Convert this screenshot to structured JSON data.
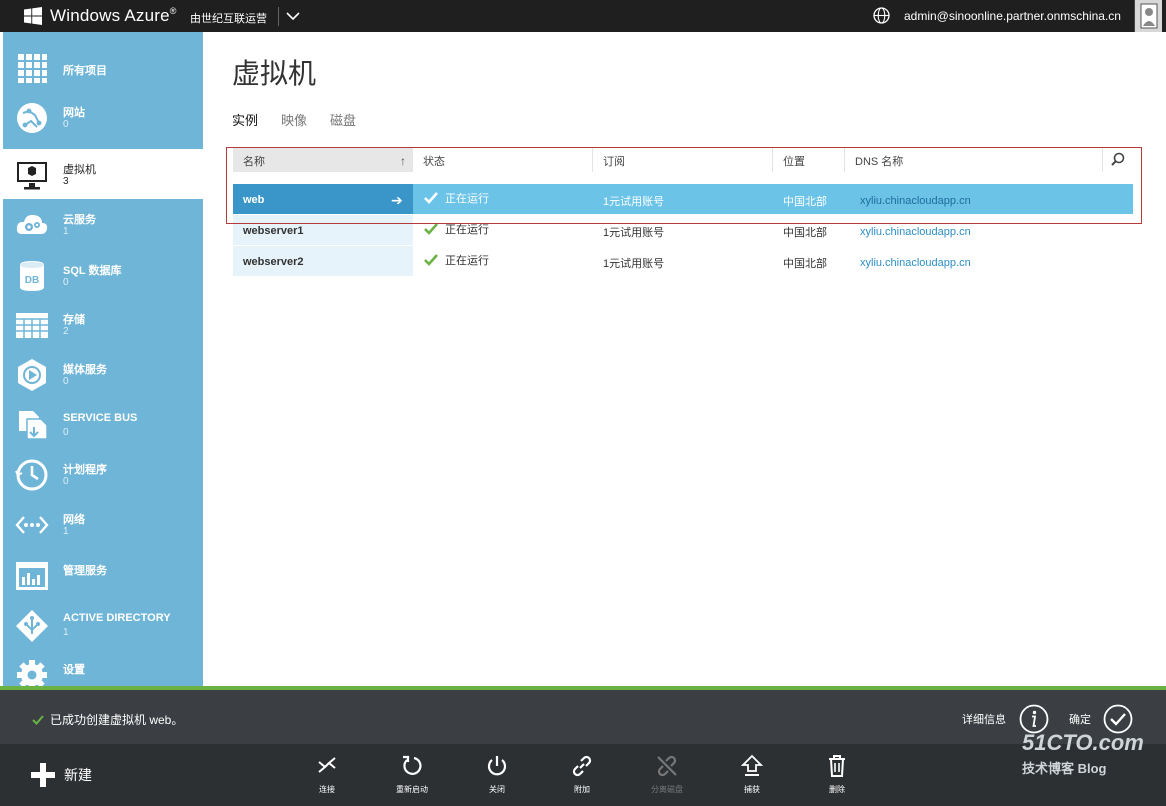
{
  "topbar": {
    "product": "Windows Azure",
    "product_sup": "®",
    "operator": "由世纪互联运营",
    "account": "admin@sinoonline.partner.onmschina.cn"
  },
  "sidebar": {
    "items": [
      {
        "label": "所有项目",
        "count": "",
        "icon": "grid-icon"
      },
      {
        "label": "网站",
        "count": "0",
        "icon": "website-globe-icon"
      },
      {
        "label": "虚拟机",
        "count": "3",
        "icon": "monitor-icon"
      },
      {
        "label": "云服务",
        "count": "1",
        "icon": "cloud-gear-icon"
      },
      {
        "label": "SQL 数据库",
        "count": "0",
        "icon": "database-icon"
      },
      {
        "label": "存储",
        "count": "2",
        "icon": "storage-table-icon"
      },
      {
        "label": "媒体服务",
        "count": "0",
        "icon": "media-play-icon"
      },
      {
        "label": "SERVICE BUS",
        "count": "0",
        "icon": "service-bus-icon"
      },
      {
        "label": "计划程序",
        "count": "0",
        "icon": "scheduler-clock-icon"
      },
      {
        "label": "网络",
        "count": "1",
        "icon": "network-icon"
      },
      {
        "label": "管理服务",
        "count": "",
        "icon": "management-icon"
      },
      {
        "label": "ACTIVE DIRECTORY",
        "count": "1",
        "icon": "active-directory-icon"
      },
      {
        "label": "设置",
        "count": "",
        "icon": "settings-gear-icon"
      }
    ]
  },
  "main": {
    "title": "虚拟机",
    "tabs": [
      "实例",
      "映像",
      "磁盘"
    ],
    "columns": [
      "名称",
      "状态",
      "订阅",
      "位置",
      "DNS 名称"
    ],
    "rows": [
      {
        "name": "web",
        "status": "正在运行",
        "subscription": "1元试用账号",
        "location": "中国北部",
        "dns": "xyliu.chinacloudapp.cn"
      },
      {
        "name": "webserver1",
        "status": "正在运行",
        "subscription": "1元试用账号",
        "location": "中国北部",
        "dns": "xyliu.chinacloudapp.cn"
      },
      {
        "name": "webserver2",
        "status": "正在运行",
        "subscription": "1元试用账号",
        "location": "中国北部",
        "dns": "xyliu.chinacloudapp.cn"
      }
    ]
  },
  "notification": {
    "message": "已成功创建虚拟机 web。",
    "details_label": "详细信息",
    "ok_label": "确定"
  },
  "commandbar": {
    "new_label": "新建",
    "commands": [
      {
        "label": "连接",
        "icon": "connect-icon",
        "enabled": true
      },
      {
        "label": "重新启动",
        "icon": "restart-icon",
        "enabled": true
      },
      {
        "label": "关闭",
        "icon": "power-icon",
        "enabled": true
      },
      {
        "label": "附加",
        "icon": "attach-link-icon",
        "enabled": true
      },
      {
        "label": "分离磁盘",
        "icon": "detach-link-icon",
        "enabled": false
      },
      {
        "label": "捕获",
        "icon": "capture-icon",
        "enabled": true
      },
      {
        "label": "删除",
        "icon": "trash-icon",
        "enabled": true
      }
    ]
  },
  "watermark": {
    "line1": "51CTO.com",
    "line2": "技术博客 Blog"
  },
  "colors": {
    "sidebar": "#6fb5d8",
    "selected_row": "#6bc3e8",
    "accent_green": "#6ab244",
    "topbar": "#1f1f1f"
  }
}
